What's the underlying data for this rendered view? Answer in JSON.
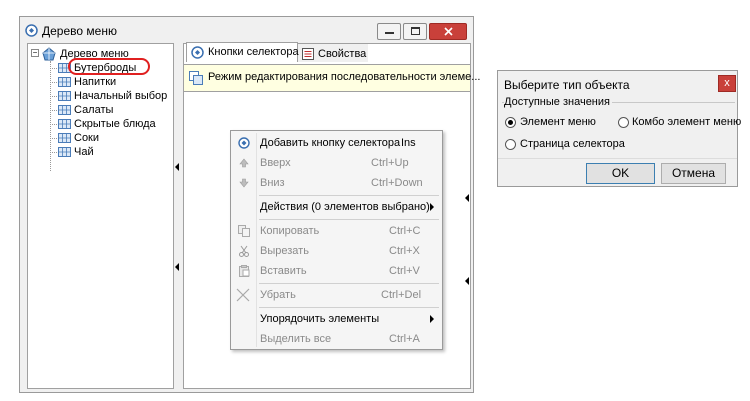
{
  "window": {
    "title": "Дерево меню"
  },
  "tree": {
    "root": "Дерево меню",
    "items": [
      {
        "label": "Бутерброды",
        "highlighted": true
      },
      {
        "label": "Напитки"
      },
      {
        "label": "Начальный выбор"
      },
      {
        "label": "Салаты"
      },
      {
        "label": "Скрытые блюда"
      },
      {
        "label": "Соки"
      },
      {
        "label": "Чай"
      }
    ]
  },
  "tabs": [
    {
      "label": "Кнопки селектора",
      "active": true
    },
    {
      "label": "Свойства",
      "active": false
    }
  ],
  "info_bar": {
    "text": "Режим редактирования последовательности элеме..."
  },
  "context_menu": {
    "items": [
      {
        "label": "Добавить кнопку селектора",
        "shortcut": "Ins",
        "enabled": true,
        "icon": "add-selector-icon"
      },
      {
        "label": "Вверх",
        "shortcut": "Ctrl+Up",
        "enabled": false,
        "icon": "arrow-up-icon"
      },
      {
        "label": "Вниз",
        "shortcut": "Ctrl+Down",
        "enabled": false,
        "icon": "arrow-down-icon"
      },
      {
        "label": "Действия (0 элементов выбрано)",
        "shortcut": "",
        "enabled": true,
        "submenu": true
      },
      {
        "label": "Копировать",
        "shortcut": "Ctrl+C",
        "enabled": false,
        "icon": "copy-icon"
      },
      {
        "label": "Вырезать",
        "shortcut": "Ctrl+X",
        "enabled": false,
        "icon": "cut-icon"
      },
      {
        "label": "Вставить",
        "shortcut": "Ctrl+V",
        "enabled": false,
        "icon": "paste-icon"
      },
      {
        "label": "Убрать",
        "shortcut": "Ctrl+Del",
        "enabled": false,
        "icon": "remove-icon"
      },
      {
        "label": "Упорядочить элементы",
        "shortcut": "",
        "enabled": true,
        "submenu": true
      },
      {
        "label": "Выделить все",
        "shortcut": "Ctrl+A",
        "enabled": false
      }
    ]
  },
  "dialog": {
    "title": "Выберите тип объекта",
    "close_label": "x",
    "group_label": "Доступные значения",
    "options": [
      {
        "label": "Элемент меню",
        "selected": true
      },
      {
        "label": "Комбо элемент меню",
        "selected": false
      },
      {
        "label": "Страница селектора",
        "selected": false
      }
    ],
    "ok_label": "OK",
    "cancel_label": "Отмена"
  },
  "colors": {
    "info_bar_bg": "#ffffe1",
    "highlight_ring": "#e02020",
    "close_button": "#c9403a"
  }
}
